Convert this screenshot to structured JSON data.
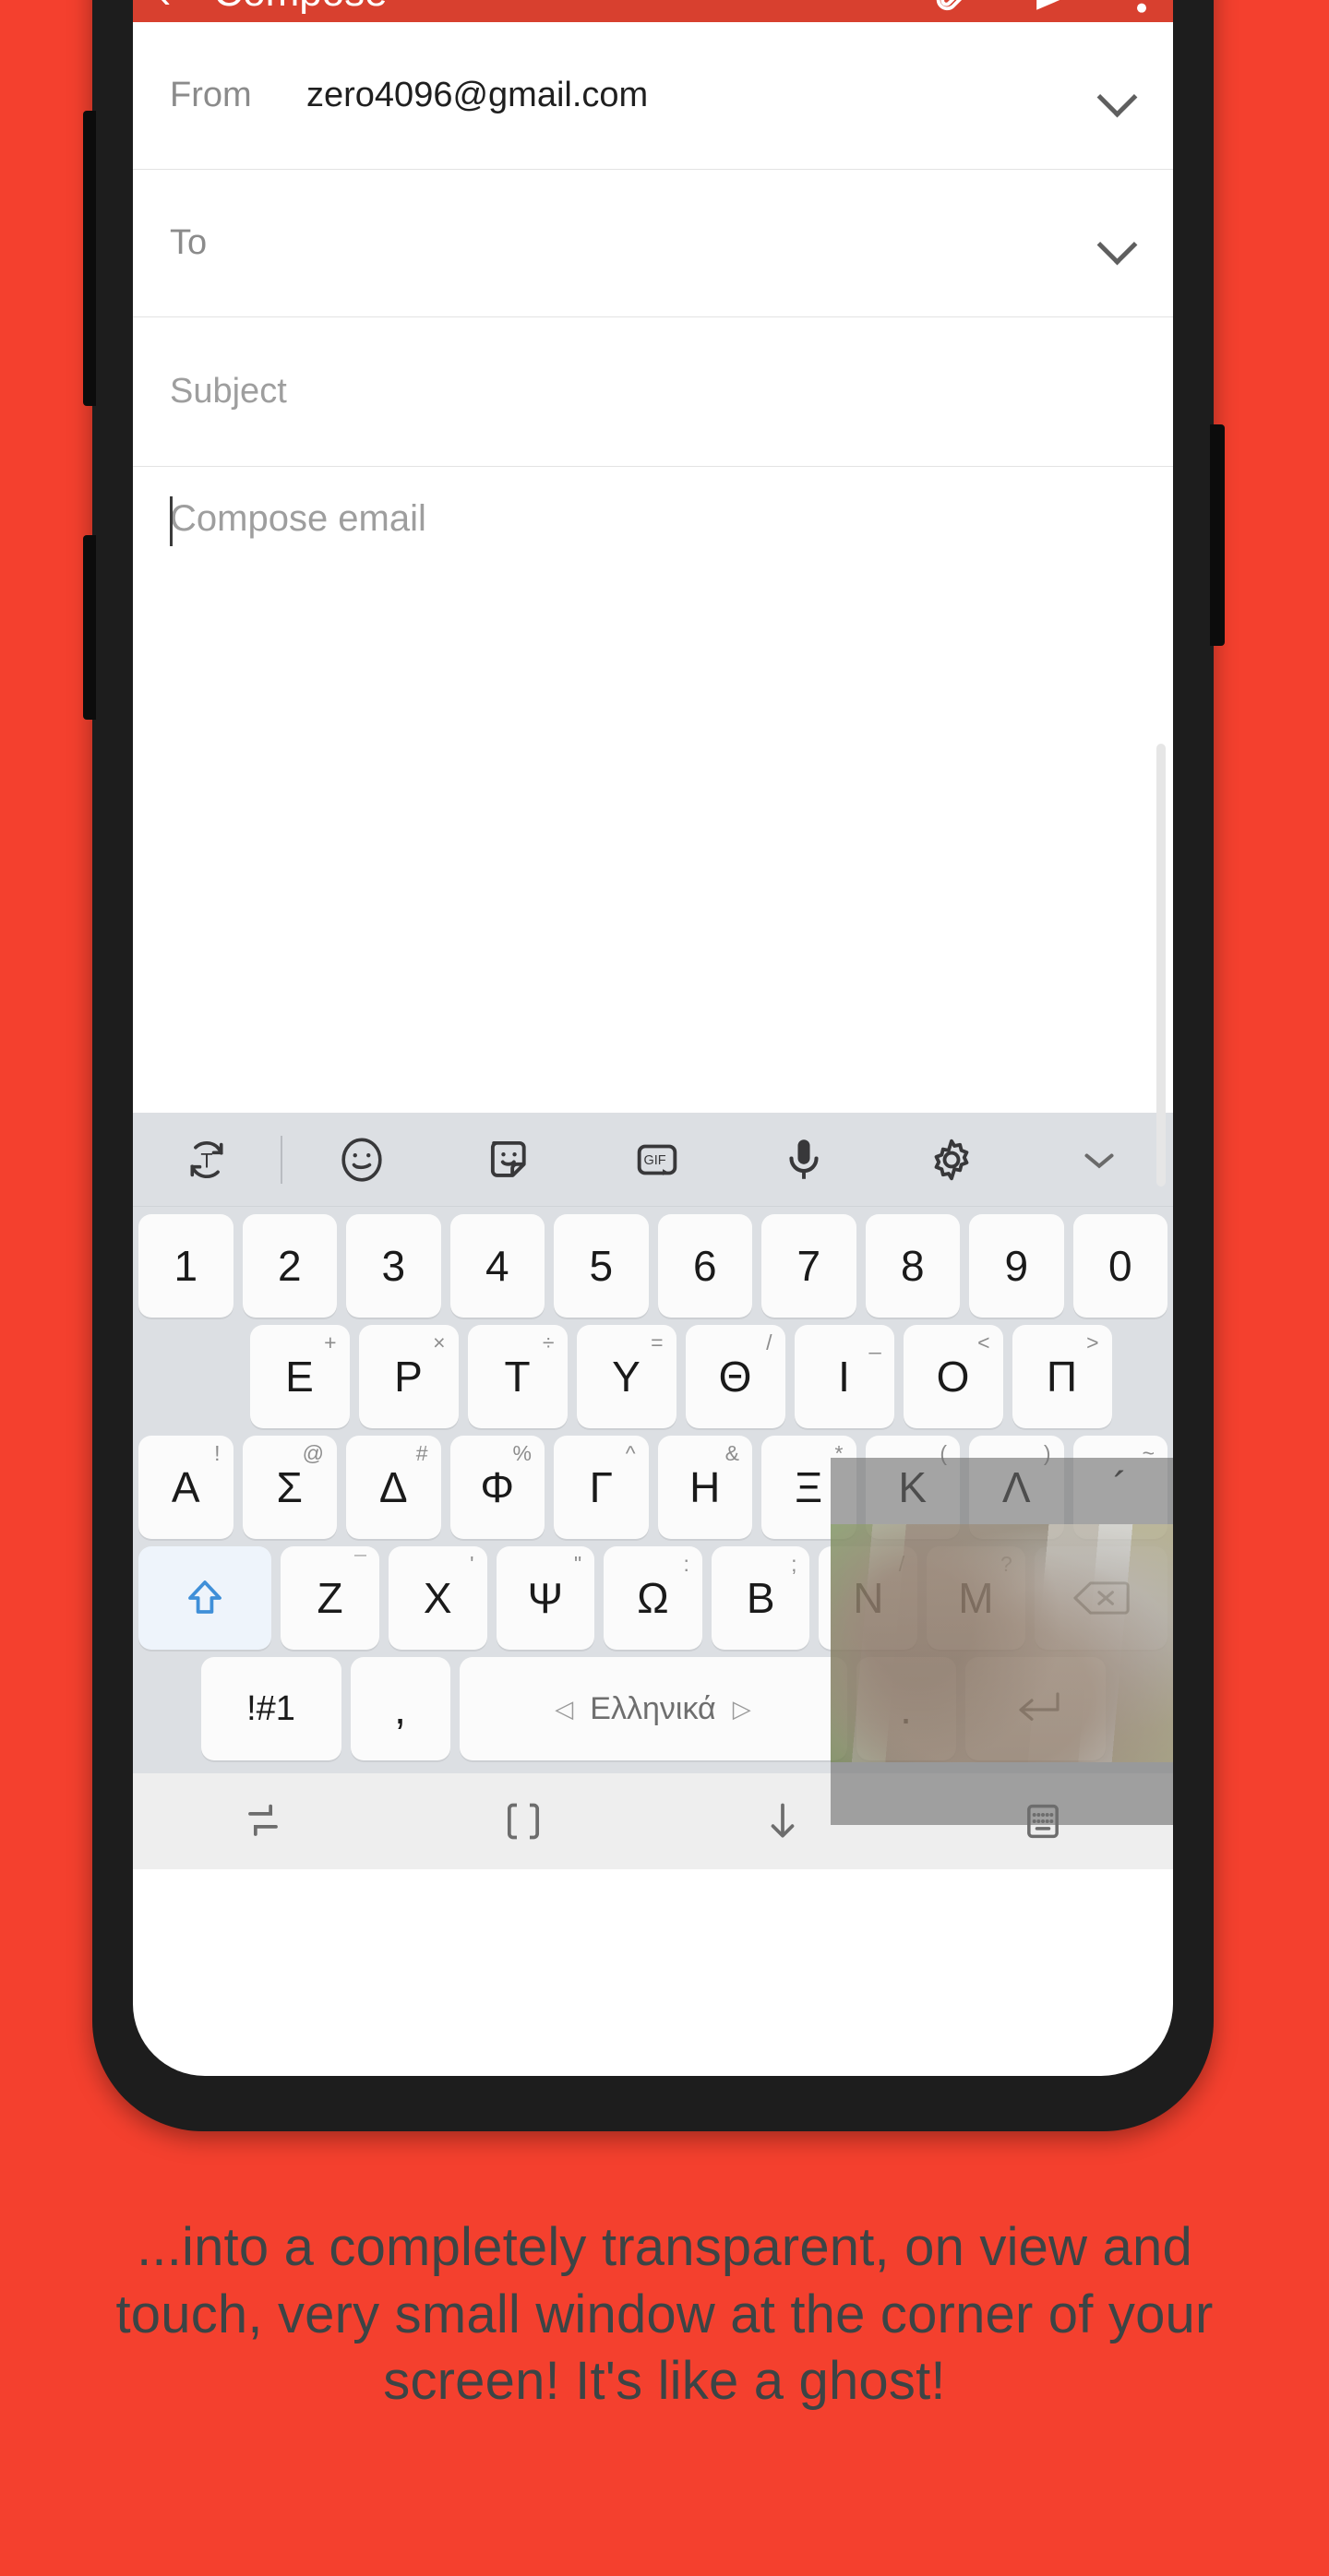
{
  "appbar": {
    "back_icon": "back-arrow-icon",
    "title": "Compose",
    "attach_icon": "attachment-icon",
    "send_icon": "send-icon",
    "more_icon": "more-vertical-icon"
  },
  "compose": {
    "from_label": "From",
    "from_value": "zero4096@gmail.com",
    "to_label": "To",
    "to_value": "",
    "subject_placeholder": "Subject",
    "body_placeholder": "Compose email"
  },
  "keyboard_toolbar": {
    "items": [
      {
        "name": "translate-icon",
        "label": "T"
      },
      {
        "name": "emoji-icon",
        "label": ""
      },
      {
        "name": "sticker-icon",
        "label": ""
      },
      {
        "name": "gif-icon",
        "label": "GIF"
      },
      {
        "name": "microphone-icon",
        "label": ""
      },
      {
        "name": "settings-gear-icon",
        "label": ""
      },
      {
        "name": "chevron-down-icon",
        "label": ""
      }
    ]
  },
  "keyboard": {
    "row_numbers": [
      "1",
      "2",
      "3",
      "4",
      "5",
      "6",
      "7",
      "8",
      "9",
      "0"
    ],
    "row_1": [
      {
        "main": "Ε",
        "sup": "+"
      },
      {
        "main": "Ρ",
        "sup": "×"
      },
      {
        "main": "Τ",
        "sup": "÷"
      },
      {
        "main": "Υ",
        "sup": "="
      },
      {
        "main": "Θ",
        "sup": "/"
      },
      {
        "main": "Ι",
        "sup": "_"
      },
      {
        "main": "Ο",
        "sup": "<"
      },
      {
        "main": "Π",
        "sup": ">"
      }
    ],
    "row_2": [
      {
        "main": "Α",
        "sup": "!"
      },
      {
        "main": "Σ",
        "sup": "@"
      },
      {
        "main": "Δ",
        "sup": "#"
      },
      {
        "main": "Φ",
        "sup": "%"
      },
      {
        "main": "Γ",
        "sup": "^"
      },
      {
        "main": "Η",
        "sup": "&"
      },
      {
        "main": "Ξ",
        "sup": "*"
      },
      {
        "main": "Κ",
        "sup": "("
      },
      {
        "main": "Λ",
        "sup": ")"
      },
      {
        "main": "´",
        "sup": "~"
      }
    ],
    "row_3": [
      {
        "main": "Ζ",
        "sup": "¯"
      },
      {
        "main": "Χ",
        "sup": "'"
      },
      {
        "main": "Ψ",
        "sup": "\""
      },
      {
        "main": "Ω",
        "sup": ":"
      },
      {
        "main": "Β",
        "sup": ";"
      },
      {
        "main": "Ν",
        "sup": "/"
      },
      {
        "main": "Μ",
        "sup": "?"
      }
    ],
    "shift_icon": "shift-up-arrow-icon",
    "backspace_icon": "backspace-icon",
    "symbols_key": "!#1",
    "comma_key": ",",
    "space_label": "Ελληνικά",
    "space_prev_icon": "prev-language-arrow-icon",
    "space_next_icon": "next-language-arrow-icon",
    "period_key": ".",
    "enter_icon": "enter-return-icon"
  },
  "navbar": {
    "items": [
      {
        "name": "recents-icon"
      },
      {
        "name": "home-icon"
      },
      {
        "name": "hide-keyboard-down-icon"
      },
      {
        "name": "keyboard-switch-icon"
      }
    ]
  },
  "overlay": {
    "name": "floating-transparent-window",
    "content": "sloth-photo"
  },
  "caption": {
    "text": "...into a completely transparent, on view and touch, very small window at the corner of your screen! It's like a ghost!"
  },
  "colors": {
    "brand_red": "#f4402e",
    "appbar_red": "#d8402f",
    "keyboard_bg": "#dcdfe3",
    "key_bg": "#fbfbfb",
    "caption_text": "#3c4445"
  }
}
